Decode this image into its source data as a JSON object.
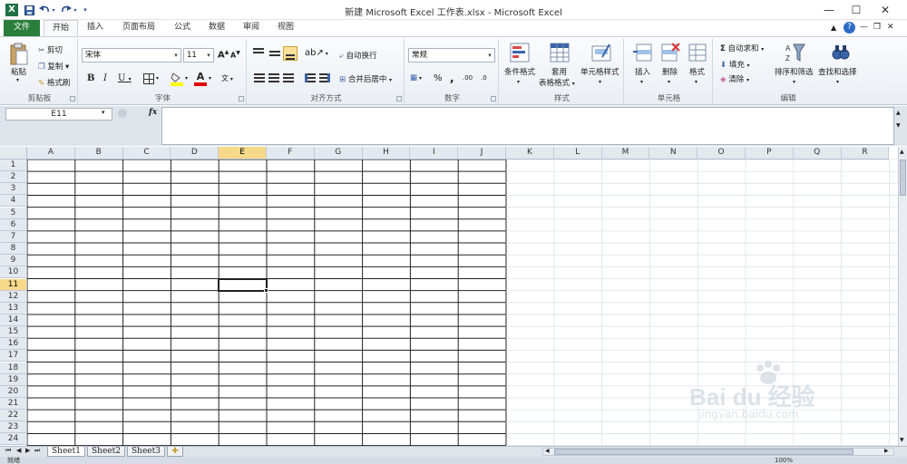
{
  "app": {
    "title": "新建 Microsoft Excel 工作表.xlsx  -  Microsoft Excel",
    "logo": "X"
  },
  "qat": {
    "save_icon": "save-icon",
    "undo_icon": "undo-icon",
    "redo_icon": "redo-icon",
    "customize_icon": "qat-customize-icon"
  },
  "window": {
    "minimize": "—",
    "maximize": "☐",
    "close": "✕"
  },
  "tabs": [
    "文件",
    "开始",
    "插入",
    "页面布局",
    "公式",
    "数据",
    "审阅",
    "视图"
  ],
  "ribbon": {
    "clipboard": {
      "label": "剪贴板",
      "paste": "粘贴",
      "cut": "剪切",
      "copy": "复制",
      "format_painter": "格式刷"
    },
    "font": {
      "label": "字体",
      "font_name": "宋体",
      "font_size": "11",
      "bold": "B",
      "italic": "I",
      "underline": "U",
      "increase": "A",
      "decrease": "A",
      "phonetic": "wén"
    },
    "alignment": {
      "label": "对齐方式",
      "wrap": "自动换行",
      "merge": "合并后居中"
    },
    "number": {
      "label": "数字",
      "format": "常规",
      "percent": "%",
      "comma": ",",
      "inc_decimal": ".00",
      "dec_decimal": ".0"
    },
    "styles": {
      "label": "样式",
      "conditional": "条件格式",
      "table": "套用\n表格格式",
      "table1": "套用",
      "table2": "表格格式",
      "cell_styles": "单元格样式"
    },
    "cells": {
      "label": "单元格",
      "insert": "插入",
      "delete": "删除",
      "format": "格式"
    },
    "editing": {
      "label": "编辑",
      "autosum": "自动求和",
      "fill": "填充",
      "clear": "清除",
      "sort": "排序和筛选",
      "find": "查找和选择"
    }
  },
  "formula_bar": {
    "name_box": "E11",
    "fx": "fx",
    "formula": ""
  },
  "columns": [
    "A",
    "B",
    "C",
    "D",
    "E",
    "F",
    "G",
    "H",
    "I",
    "J",
    "K",
    "L",
    "M",
    "N",
    "O",
    "P",
    "Q",
    "R"
  ],
  "rows": [
    "1",
    "2",
    "3",
    "4",
    "5",
    "6",
    "7",
    "8",
    "9",
    "10",
    "11",
    "12",
    "13",
    "14",
    "15",
    "16",
    "17",
    "18",
    "19",
    "20",
    "21",
    "22",
    "23",
    "24"
  ],
  "selected": {
    "cell": "E11",
    "column": "E",
    "row": "11"
  },
  "sheets": [
    "Sheet1",
    "Sheet2",
    "Sheet3"
  ],
  "status": {
    "ready": "就绪",
    "zoom": "100%"
  },
  "watermark": {
    "brand": "Bai du 经验",
    "url": "jingyan.baidu.com"
  },
  "colors": {
    "accent": "#2a7e3b",
    "selection": "#f7d98a",
    "header": "#e4e9ef"
  }
}
